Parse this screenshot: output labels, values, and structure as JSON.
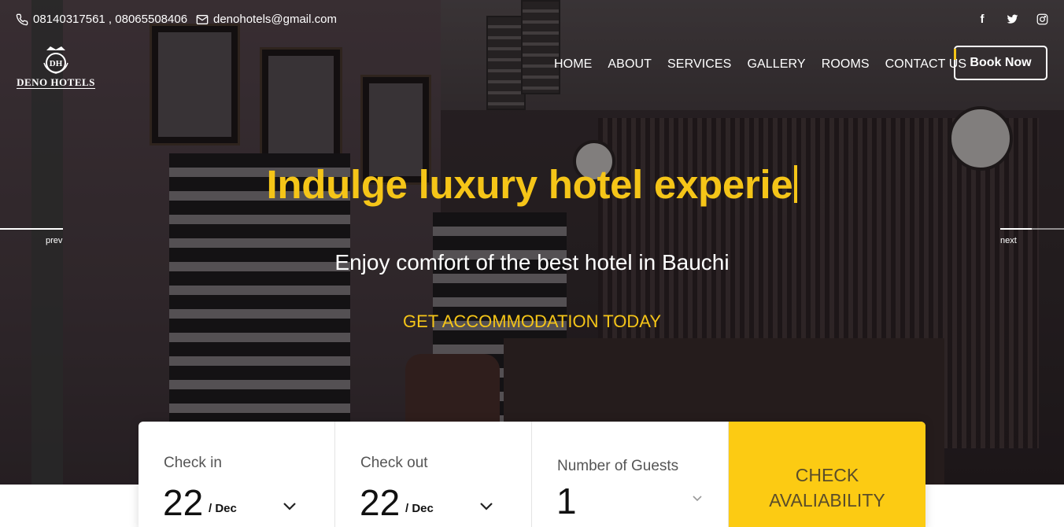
{
  "topbar": {
    "phone": "08140317561 , 08065508406",
    "email": "denohotels@gmail.com",
    "social": [
      {
        "icon": "facebook-icon",
        "glyph": "f"
      },
      {
        "icon": "twitter-icon",
        "glyph": "t"
      },
      {
        "icon": "instagram-icon",
        "glyph": "◎"
      }
    ]
  },
  "logo": {
    "monogram": "DH",
    "name": "DENO HOTELS"
  },
  "nav": {
    "items": [
      "HOME",
      "ABOUT",
      "SERVICES",
      "GALLERY",
      "ROOMS",
      "CONTACT US"
    ],
    "book_label": "Book Now"
  },
  "slider": {
    "prev_label": "prev",
    "next_label": "next"
  },
  "hero": {
    "headline": "Indulge luxury hotel experie",
    "subline": "Enjoy comfort of the best hotel in Bauchi",
    "cta": "GET ACCOMMODATION TODAY"
  },
  "booking": {
    "checkin": {
      "label": "Check in",
      "day": "22",
      "month": "/ Dec"
    },
    "checkout": {
      "label": "Check out",
      "day": "22",
      "month": "/ Dec"
    },
    "guests": {
      "label": "Number of Guests",
      "value": "1"
    },
    "check_label_line1": "CHECK",
    "check_label_line2": "AVALIABILITY"
  },
  "colors": {
    "accent": "#f5c518",
    "button_yellow": "#fccb13"
  }
}
